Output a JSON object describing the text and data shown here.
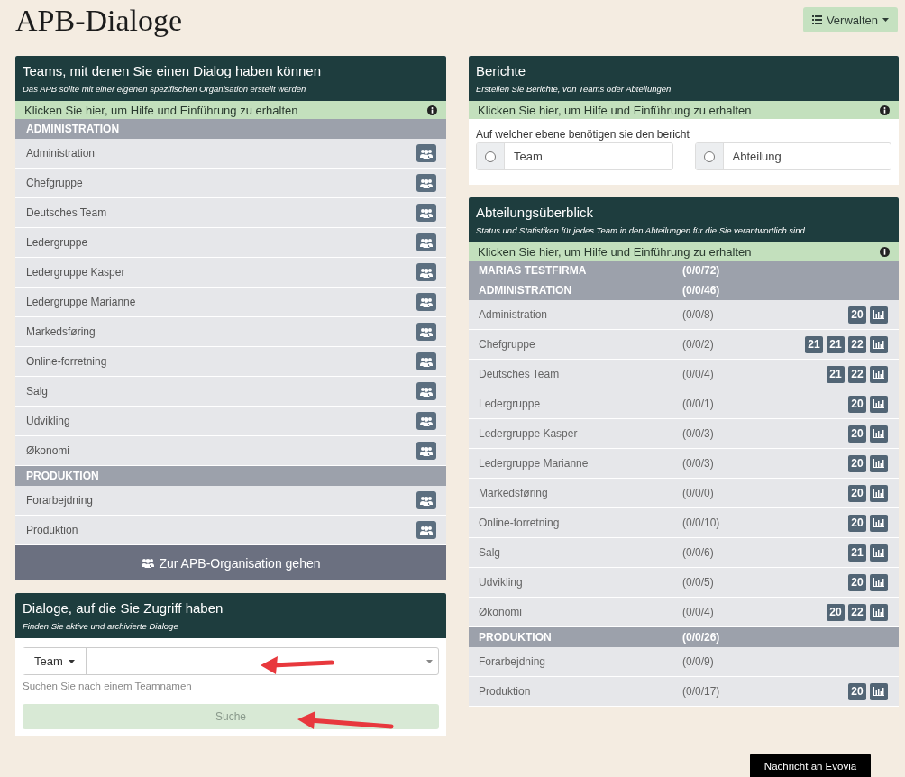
{
  "page_title": "APB-Dialoge",
  "manage_button": {
    "label": "Verwalten"
  },
  "teams_panel": {
    "title": "Teams, mit denen Sie einen Dialog haben können",
    "subtitle": "Das APB sollte mit einer eigenen spezifischen Organisation erstellt werden",
    "help": "Klicken Sie hier, um Hilfe und Einführung zu erhalten",
    "groups": [
      {
        "name": "ADMINISTRATION",
        "teams": [
          "Administration",
          "Chefgruppe",
          "Deutsches Team",
          "Ledergruppe",
          "Ledergruppe Kasper",
          "Ledergruppe Marianne",
          "Markedsføring",
          "Online-forretning",
          "Salg",
          "Udvikling",
          "Økonomi"
        ]
      },
      {
        "name": "PRODUKTION",
        "teams": [
          "Forarbejdning",
          "Produktion"
        ]
      }
    ],
    "go_button": "Zur APB-Organisation gehen"
  },
  "dialogs_panel": {
    "title": "Dialoge, auf die Sie Zugriff haben",
    "subtitle": "Finden Sie aktive und archivierte Dialoge",
    "type_dropdown": "Team",
    "hint": "Suchen Sie nach einem Teamnamen",
    "search_button": {
      "label": "Suche",
      "disabled": true
    }
  },
  "reports_panel": {
    "title": "Berichte",
    "subtitle": "Erstellen Sie Berichte, von Teams oder Abteilungen",
    "help": "Klicken Sie hier, um Hilfe und Einführung zu erhalten",
    "question": "Auf welcher ebene benötigen sie den bericht",
    "options": [
      {
        "label": "Team",
        "selected": false
      },
      {
        "label": "Abteilung",
        "selected": false
      }
    ]
  },
  "overview_panel": {
    "title": "Abteilungsüberblick",
    "subtitle": "Status und Statistiken für jedes Team in den Abteilungen für die Sie verantwortlich sind",
    "help": "Klicken Sie hier, um Hilfe und Einführung zu erhalten",
    "rows": [
      {
        "kind": "header",
        "name": "MARIAS TESTFIRMA",
        "count": "(0/0/72)"
      },
      {
        "kind": "header",
        "name": "ADMINISTRATION",
        "count": "(0/0/46)"
      },
      {
        "kind": "team",
        "name": "Administration",
        "count": "(0/0/8)",
        "badges": [
          "20"
        ],
        "chart": true
      },
      {
        "kind": "team",
        "name": "Chefgruppe",
        "count": "(0/0/2)",
        "badges": [
          "21",
          "21",
          "22"
        ],
        "chart": true
      },
      {
        "kind": "team",
        "name": "Deutsches Team",
        "count": "(0/0/4)",
        "badges": [
          "21",
          "22"
        ],
        "chart": true
      },
      {
        "kind": "team",
        "name": "Ledergruppe",
        "count": "(0/0/1)",
        "badges": [
          "20"
        ],
        "chart": true
      },
      {
        "kind": "team",
        "name": "Ledergruppe Kasper",
        "count": "(0/0/3)",
        "badges": [
          "20"
        ],
        "chart": true
      },
      {
        "kind": "team",
        "name": "Ledergruppe Marianne",
        "count": "(0/0/3)",
        "badges": [
          "20"
        ],
        "chart": true
      },
      {
        "kind": "team",
        "name": "Markedsføring",
        "count": "(0/0/0)",
        "badges": [
          "20"
        ],
        "chart": true
      },
      {
        "kind": "team",
        "name": "Online-forretning",
        "count": "(0/0/10)",
        "badges": [
          "20"
        ],
        "chart": true
      },
      {
        "kind": "team",
        "name": "Salg",
        "count": "(0/0/6)",
        "badges": [
          "21"
        ],
        "chart": true
      },
      {
        "kind": "team",
        "name": "Udvikling",
        "count": "(0/0/5)",
        "badges": [
          "20"
        ],
        "chart": true
      },
      {
        "kind": "team",
        "name": "Økonomi",
        "count": "(0/0/4)",
        "badges": [
          "20",
          "22"
        ],
        "chart": true
      },
      {
        "kind": "header",
        "name": "PRODUKTION",
        "count": "(0/0/26)"
      },
      {
        "kind": "team",
        "name": "Forarbejdning",
        "count": "(0/0/9)",
        "badges": [],
        "chart": false
      },
      {
        "kind": "team",
        "name": "Produktion",
        "count": "(0/0/17)",
        "badges": [
          "20"
        ],
        "chart": true
      }
    ]
  },
  "message_button": "Nachricht an Evovia"
}
